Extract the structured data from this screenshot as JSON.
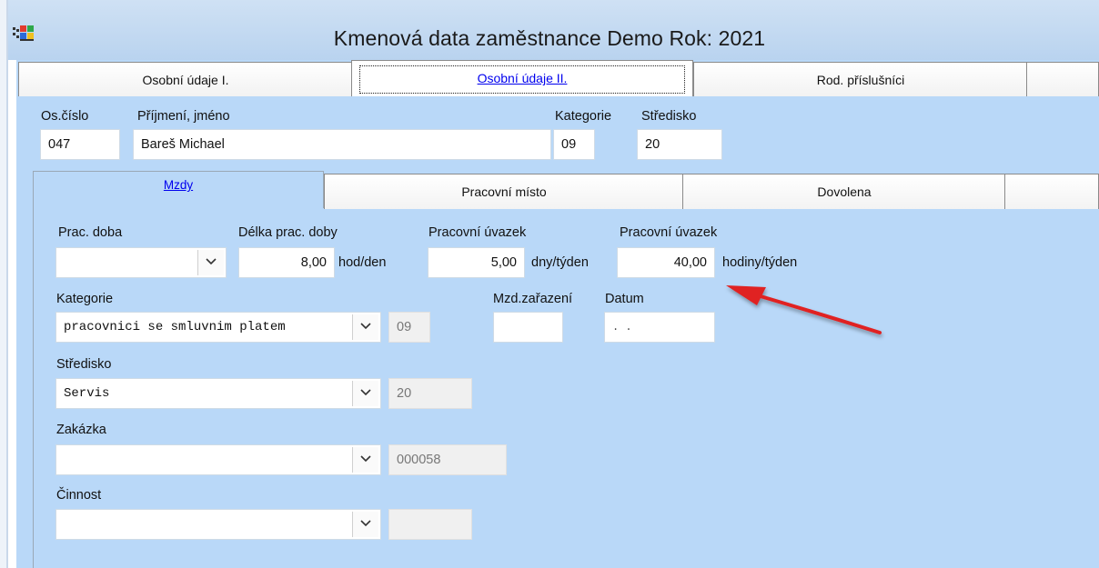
{
  "window": {
    "title": "Kmenová data zaměstnance  Demo  Rok: 2021"
  },
  "outer_tabs": [
    {
      "label": "Osobní údaje I.",
      "active": false
    },
    {
      "label": "Osobní údaje II.",
      "active": true
    },
    {
      "label": "Rod. příslušníci",
      "active": false
    }
  ],
  "header": {
    "os_cislo_label": "Os.číslo",
    "os_cislo_value": "047",
    "jmeno_label": "Příjmení, jméno",
    "jmeno_value": "Bareš Michael",
    "kategorie_label": "Kategorie",
    "kategorie_value": "09",
    "stredisko_label": "Středisko",
    "stredisko_value": "20"
  },
  "inner_tabs": [
    {
      "label": "Mzdy",
      "active": true
    },
    {
      "label": "Pracovní místo",
      "active": false
    },
    {
      "label": "Dovolena",
      "active": false
    }
  ],
  "mzdy": {
    "prac_doba_label": "Prac. doba",
    "prac_doba_value": "",
    "delka_label": "Délka prac. doby",
    "delka_value": "8,00",
    "delka_unit": "hod/den",
    "uvazek_dny_label": "Pracovní úvazek",
    "uvazek_dny_value": "5,00",
    "uvazek_dny_unit": "dny/týden",
    "uvazek_hod_label": "Pracovní úvazek",
    "uvazek_hod_value": "40,00",
    "uvazek_hod_unit": "hodiny/týden",
    "kategorie_label": "Kategorie",
    "kategorie_value": "pracovnici se smluvnim platem",
    "kategorie_code": "09",
    "mzd_zarazeni_label": "Mzd.zařazení",
    "mzd_zarazeni_value": "",
    "datum_label": "Datum",
    "datum_value": " . .",
    "stredisko_label": "Středisko",
    "stredisko_value": "Servis",
    "stredisko_code": "20",
    "zakazka_label": "Zakázka",
    "zakazka_value": "",
    "zakazka_code": "000058",
    "cinnost_label": "Činnost",
    "cinnost_value": "",
    "cinnost_code": ""
  },
  "colors": {
    "panel_bg": "#b9d8f8",
    "arrow": "#e02020",
    "active_tab_text": "#0000ee"
  },
  "icons": {
    "app": "app-windows-flag-icon",
    "dropdown": "chevron-down-icon",
    "annotation": "red-arrow-annotation"
  }
}
